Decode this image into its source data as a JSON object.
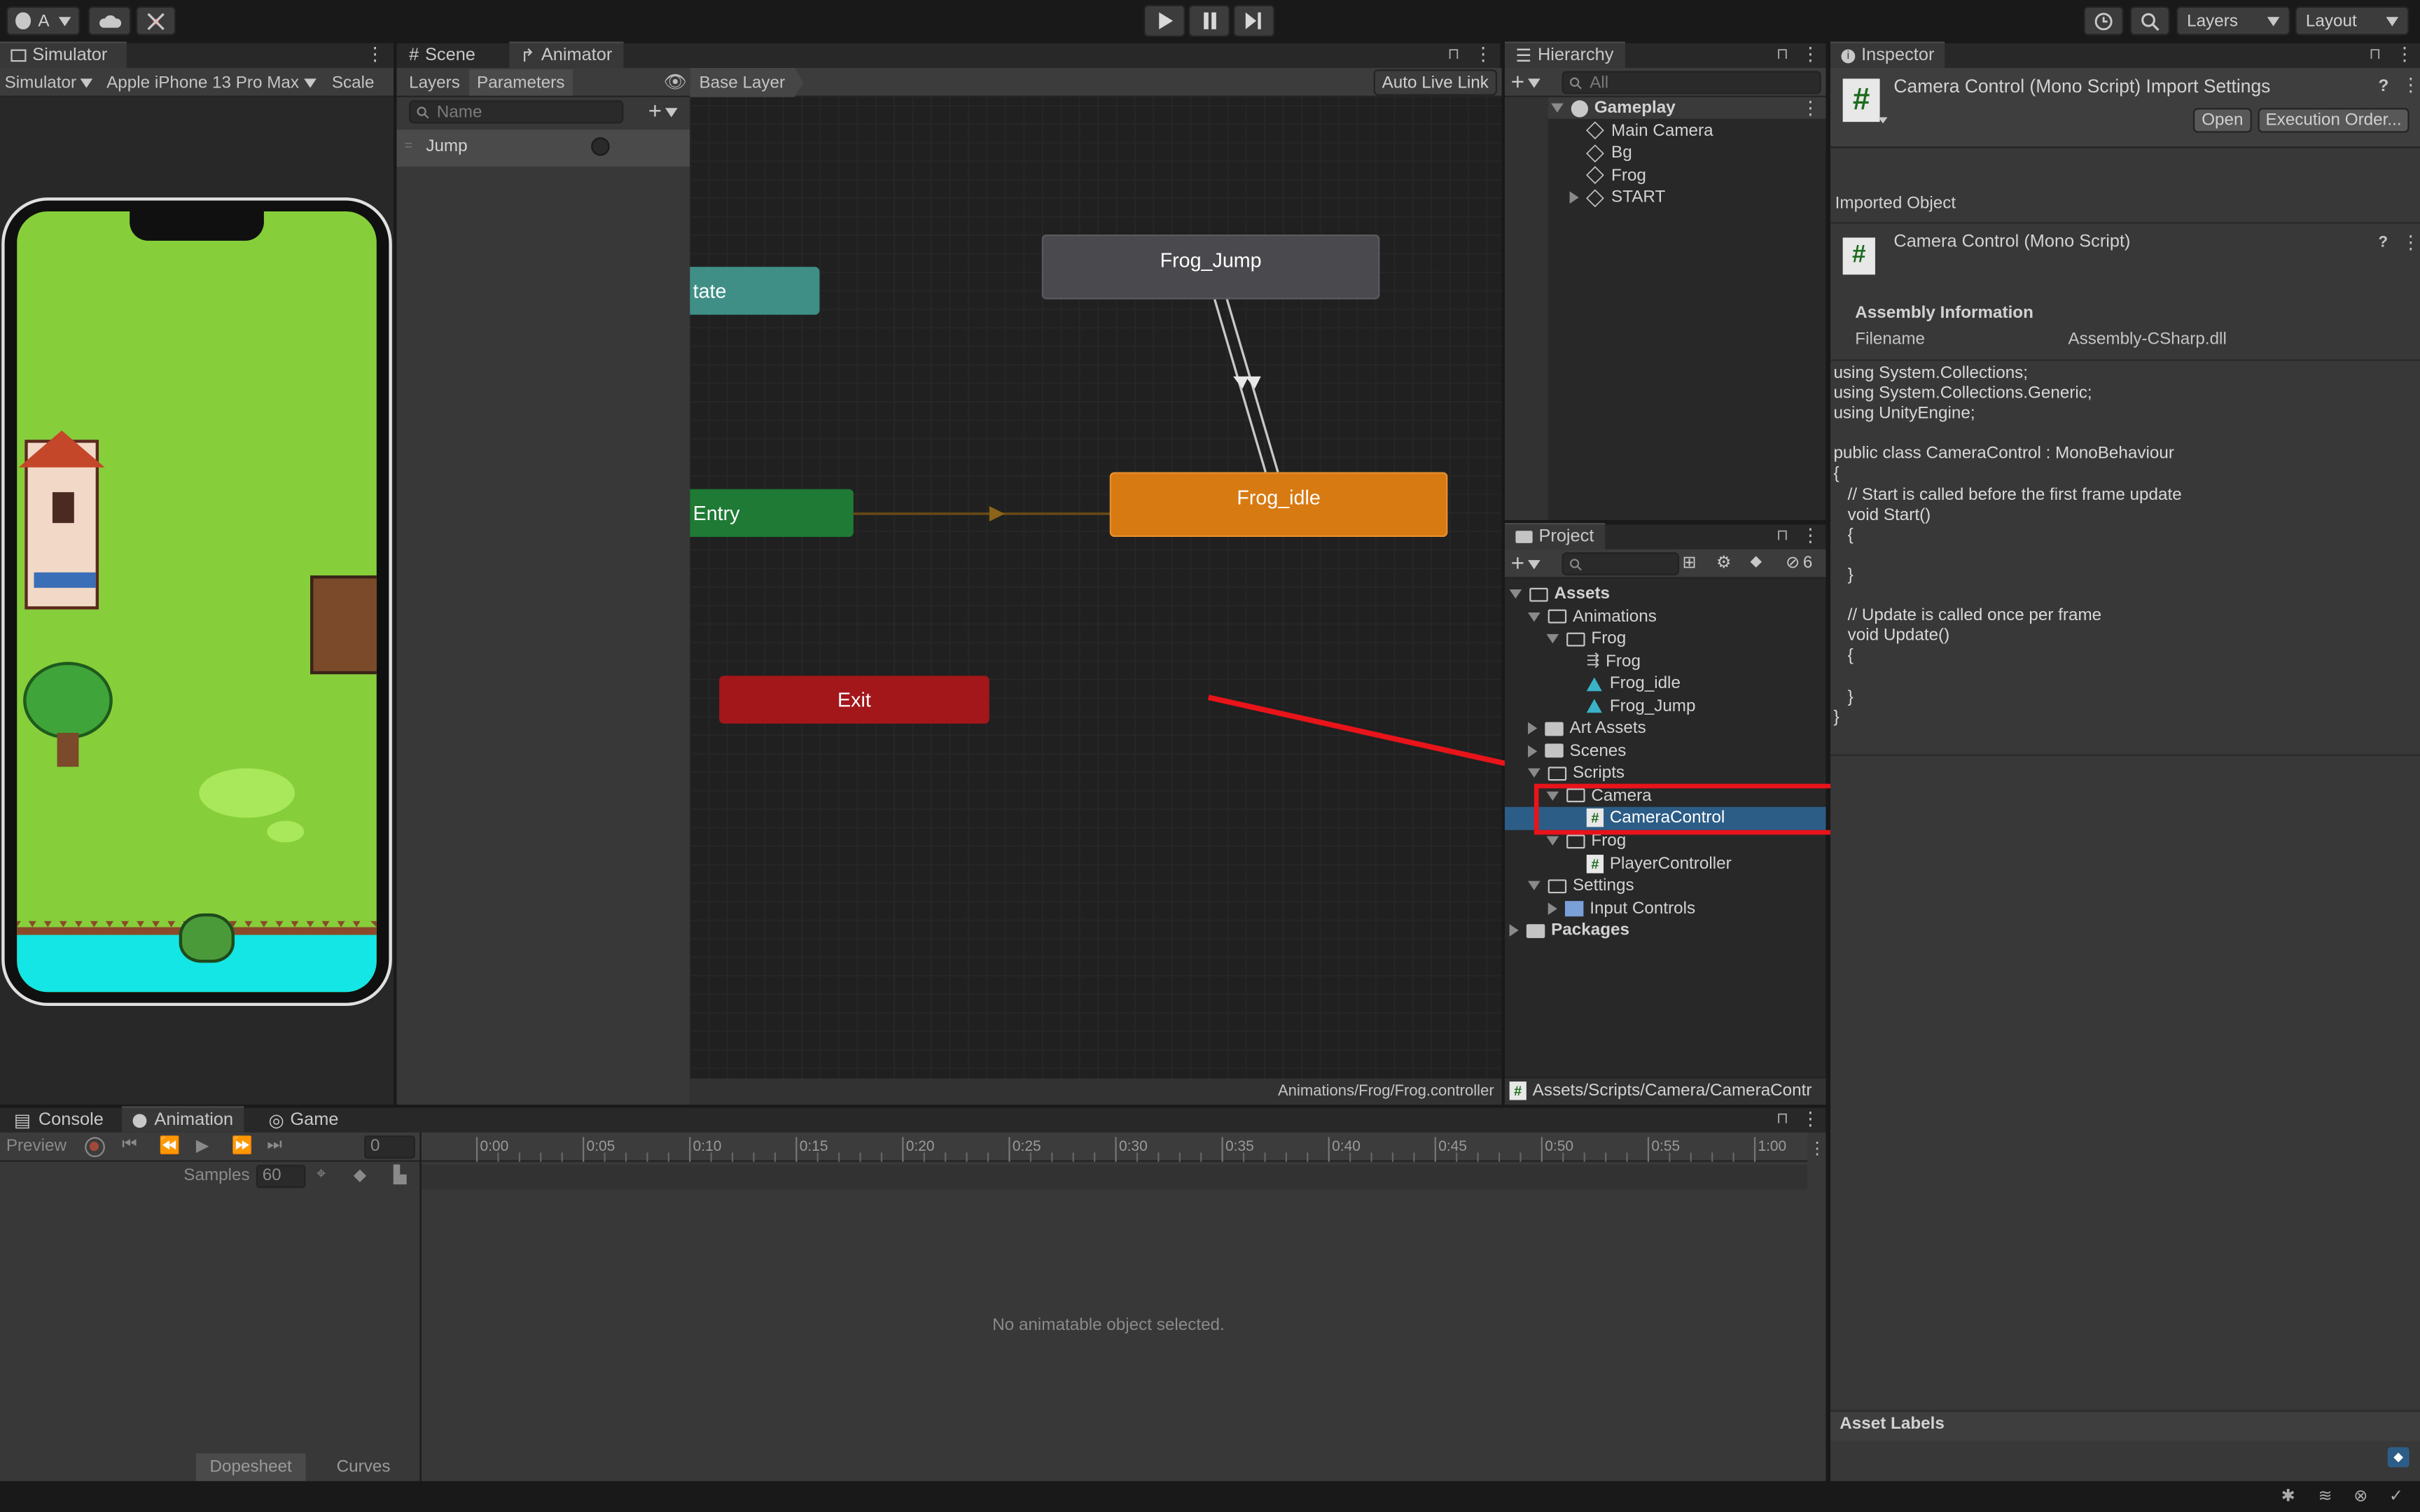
{
  "toolbar": {
    "account": "A",
    "layers": "Layers",
    "layout": "Layout"
  },
  "simulator": {
    "tab": "Simulator",
    "mode": "Simulator",
    "device": "Apple iPhone 13 Pro Max",
    "scale": "Scale"
  },
  "scene_tab": "Scene",
  "animator_tab": "Animator",
  "animator": {
    "layers": "Layers",
    "parameters": "Parameters",
    "name_placeholder": "Name",
    "param": "Jump",
    "base_layer": "Base Layer",
    "auto_live_link": "Auto Live Link",
    "path": "Animations/Frog/Frog.controller",
    "nodes": {
      "any_state": "tate",
      "entry": "Entry",
      "exit": "Exit",
      "frog_jump": "Frog_Jump",
      "frog_idle": "Frog_idle"
    }
  },
  "hierarchy": {
    "tab": "Hierarchy",
    "search": "All",
    "scene": "Gameplay",
    "items": [
      "Main Camera",
      "Bg",
      "Frog",
      "START"
    ]
  },
  "project": {
    "tab": "Project",
    "count": "6",
    "path": "Assets/Scripts/Camera/CameraContr",
    "tree": {
      "assets": "Assets",
      "animations": "Animations",
      "frog_folder": "Frog",
      "frog_ctrl": "Frog",
      "frog_idle": "Frog_idle",
      "frog_jump": "Frog_Jump",
      "art_assets": "Art Assets",
      "scenes": "Scenes",
      "scripts": "Scripts",
      "camera": "Camera",
      "camera_control": "CameraControl",
      "frog2": "Frog",
      "player_controller": "PlayerController",
      "settings": "Settings",
      "input_controls": "Input Controls",
      "packages": "Packages"
    }
  },
  "inspector": {
    "tab": "Inspector",
    "title": "Camera Control (Mono Script) Import Settings",
    "open": "Open",
    "exec_order": "Execution Order...",
    "imported_object": "Imported Object",
    "object_name": "Camera Control (Mono Script)",
    "assembly_info": "Assembly Information",
    "filename_label": "Filename",
    "filename_value": "Assembly-CSharp.dll",
    "asset_labels": "Asset Labels",
    "code": "using System.Collections;\nusing System.Collections.Generic;\nusing UnityEngine;\n\npublic class CameraControl : MonoBehaviour\n{\n   // Start is called before the first frame update\n   void Start()\n   {\n\n   }\n\n   // Update is called once per frame\n   void Update()\n   {\n\n   }\n}"
  },
  "bottom": {
    "console": "Console",
    "animation": "Animation",
    "game": "Game",
    "preview": "Preview",
    "frame": "0",
    "samples_label": "Samples",
    "samples_value": "60",
    "empty_msg": "No animatable object selected.",
    "dopesheet": "Dopesheet",
    "curves": "Curves",
    "ticks": [
      "0:00",
      "0:05",
      "0:10",
      "0:15",
      "0:20",
      "0:25",
      "0:30",
      "0:35",
      "0:40",
      "0:45",
      "0:50",
      "0:55",
      "1:00"
    ]
  },
  "colors": {
    "selection": "#2c5d87",
    "highlight_box": "#e8141a",
    "arrow": "#e8141a",
    "entry": "#1e7a34",
    "exit": "#a3161a",
    "idle": "#d87a12",
    "jump": "#4a4a4e",
    "anystate": "#3f8f86",
    "grass": "#86cf3b",
    "water": "#13e6e4"
  }
}
